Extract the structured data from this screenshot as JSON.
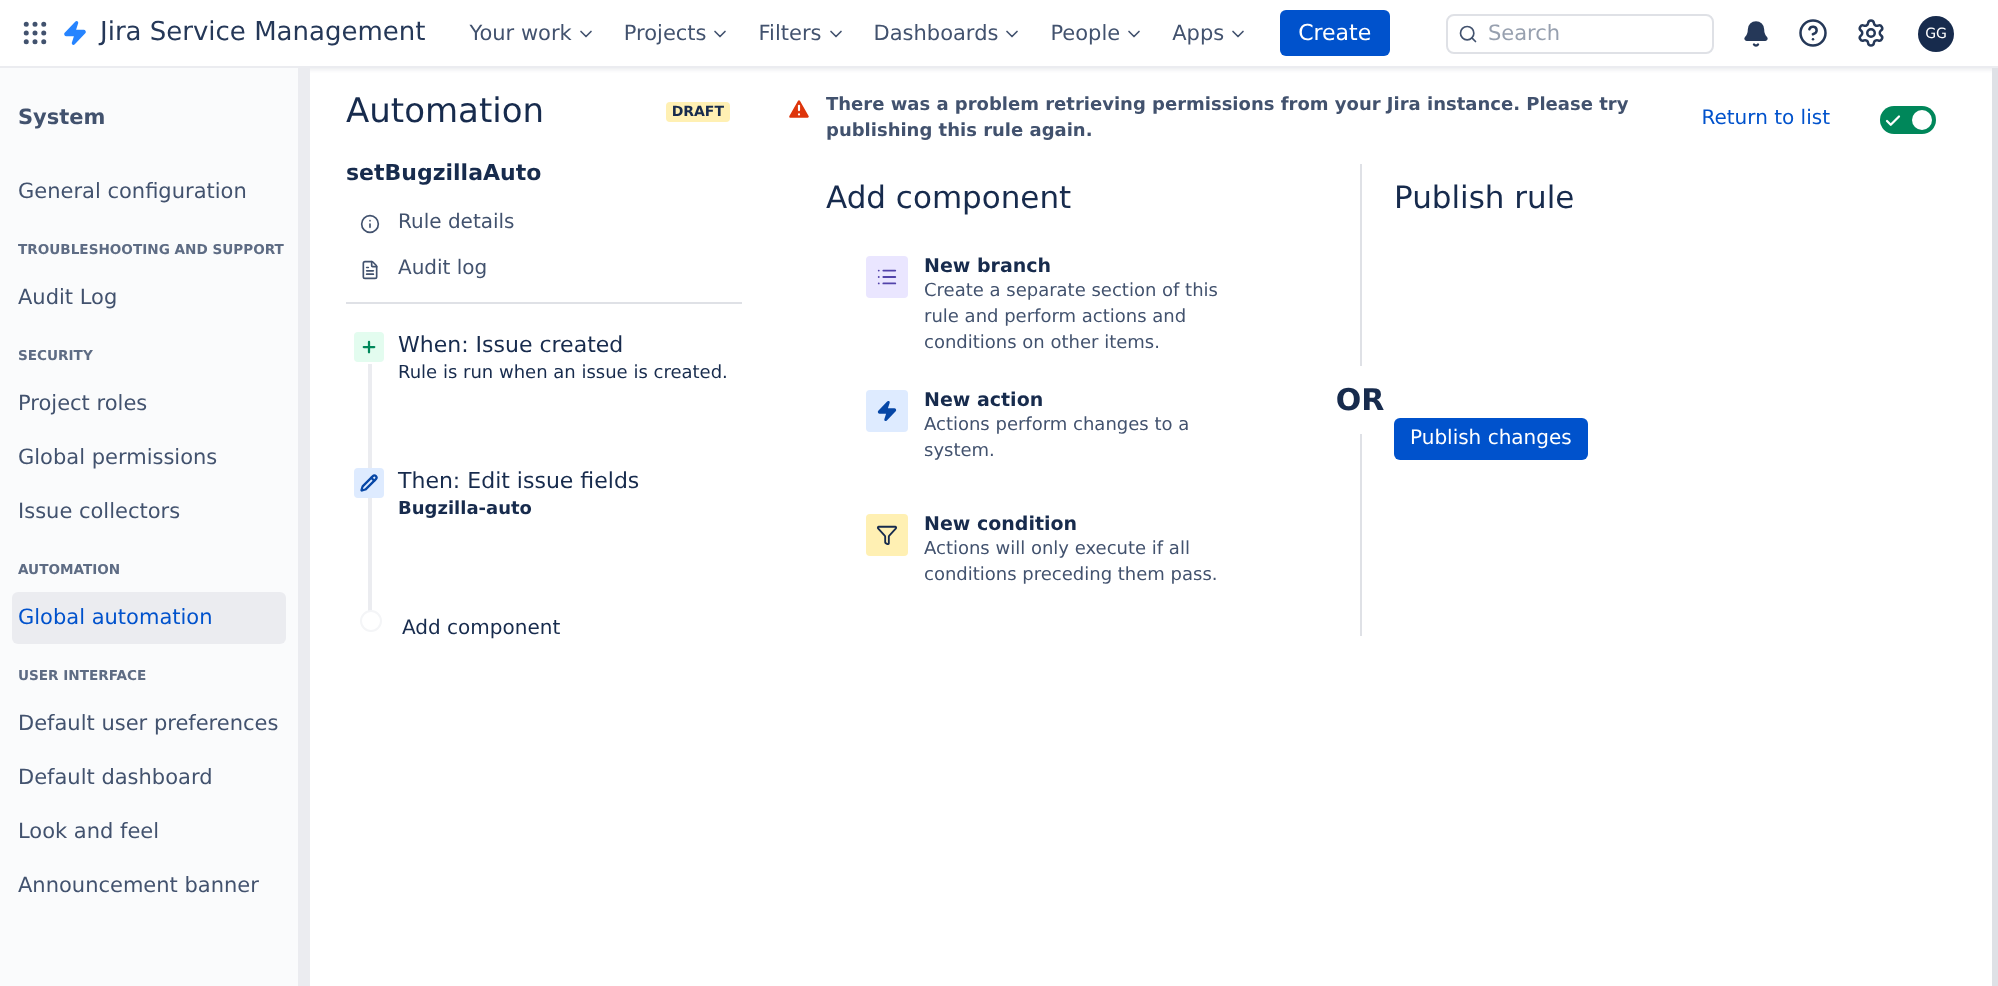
{
  "topbar": {
    "product": "Jira Service Management",
    "menus": [
      {
        "label": "Your work"
      },
      {
        "label": "Projects"
      },
      {
        "label": "Filters"
      },
      {
        "label": "Dashboards"
      },
      {
        "label": "People"
      },
      {
        "label": "Apps"
      }
    ],
    "create": "Create",
    "search": {
      "placeholder": "Search"
    },
    "avatar": "GG"
  },
  "sidebar": {
    "title": "System",
    "groups": [
      {
        "items": [
          {
            "label": "General configuration",
            "selected": false
          }
        ]
      },
      {
        "heading": "TROUBLESHOOTING AND SUPPORT",
        "items": [
          {
            "label": "Audit Log",
            "selected": false
          }
        ]
      },
      {
        "heading": "SECURITY",
        "items": [
          {
            "label": "Project roles",
            "selected": false
          },
          {
            "label": "Global permissions",
            "selected": false
          },
          {
            "label": "Issue collectors",
            "selected": false
          }
        ]
      },
      {
        "heading": "AUTOMATION",
        "items": [
          {
            "label": "Global automation",
            "selected": true
          }
        ]
      },
      {
        "heading": "USER INTERFACE",
        "items": [
          {
            "label": "Default user preferences",
            "selected": false
          },
          {
            "label": "Default dashboard",
            "selected": false
          },
          {
            "label": "Look and feel",
            "selected": false
          },
          {
            "label": "Announcement banner",
            "selected": false
          }
        ]
      }
    ]
  },
  "rule": {
    "title": "Automation",
    "status": "DRAFT",
    "name": "setBugzillaAuto",
    "links": [
      {
        "kind": "info",
        "label": "Rule details"
      },
      {
        "kind": "log",
        "label": "Audit log"
      }
    ],
    "steps": [
      {
        "kind": "trigger",
        "title": "When: Issue created",
        "detail": "Rule is run when an issue is created."
      },
      {
        "kind": "action",
        "title": "Then: Edit issue fields",
        "detail": "Bugzilla-auto"
      },
      {
        "kind": "add",
        "title": "Add component"
      }
    ]
  },
  "alert": {
    "message": "There was a problem retrieving permissions from your Jira instance. Please try publishing this rule again.",
    "return_link": "Return to list",
    "enabled": true
  },
  "add_component": {
    "title": "Add component",
    "options": [
      {
        "kind": "branch",
        "title": "New branch",
        "description": "Create a separate section of this rule and perform actions and conditions on other items."
      },
      {
        "kind": "action",
        "title": "New action",
        "description": "Actions perform changes to a system."
      },
      {
        "kind": "condition",
        "title": "New condition",
        "description": "Actions will only execute if all conditions preceding them pass."
      }
    ]
  },
  "separator": "OR",
  "publish": {
    "title": "Publish rule",
    "button": "Publish changes"
  }
}
